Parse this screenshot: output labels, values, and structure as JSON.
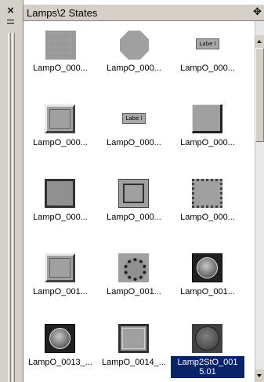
{
  "window": {
    "title": "Lamps\\2 States",
    "close_glyph": "×",
    "title_icon_glyph": "✥"
  },
  "items": [
    {
      "label": "LampO_000...",
      "icon": "lamp-flat-square-icon"
    },
    {
      "label": "LampO_000...",
      "icon": "lamp-octagon-icon"
    },
    {
      "label": "LampO_000...",
      "icon": "lamp-label-icon",
      "text": "Labe l"
    },
    {
      "label": "LampO_000...",
      "icon": "lamp-bevel-square-icon"
    },
    {
      "label": "LampO_000...",
      "icon": "lamp-label-icon",
      "text": "Labe l"
    },
    {
      "label": "LampO_000...",
      "icon": "lamp-raised-square-icon"
    },
    {
      "label": "LampO_000...",
      "icon": "lamp-dark-border-icon"
    },
    {
      "label": "LampO_000...",
      "icon": "lamp-inset-square-icon"
    },
    {
      "label": "LampO_000...",
      "icon": "lamp-riveted-square-icon"
    },
    {
      "label": "LampO_001...",
      "icon": "lamp-bevel-square-icon"
    },
    {
      "label": "LampO_001...",
      "icon": "lamp-ring-icon"
    },
    {
      "label": "LampO_001...",
      "icon": "lamp-black-circle-icon"
    },
    {
      "label": "LampO_0013_...",
      "icon": "lamp-black-circle-icon"
    },
    {
      "label": "LampO_0014_...",
      "icon": "lamp-plain-square-icon"
    },
    {
      "label": "Lamp2StO_001 5.01",
      "icon": "lamp-dark-circle-icon",
      "selected": true
    }
  ]
}
